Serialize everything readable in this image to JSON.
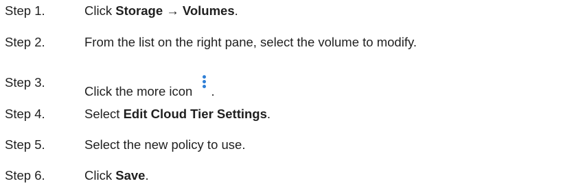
{
  "steps": [
    {
      "label": "Step 1.",
      "parts": [
        {
          "text": "Click "
        },
        {
          "text": "Storage → Volumes",
          "bold": true
        },
        {
          "text": "."
        }
      ]
    },
    {
      "label": "Step 2.",
      "parts": [
        {
          "text": "From the list on the right pane, select the volume to modify."
        }
      ]
    },
    {
      "label": "Step 3.",
      "parts": [
        {
          "text": "Click the more icon "
        },
        {
          "icon": "more-vertical-icon"
        },
        {
          "text": "."
        }
      ]
    },
    {
      "label": "Step 4.",
      "parts": [
        {
          "text": "Select "
        },
        {
          "text": "Edit Cloud Tier Settings",
          "bold": true
        },
        {
          "text": "."
        }
      ]
    },
    {
      "label": "Step 5.",
      "parts": [
        {
          "text": "Select the new policy to use."
        }
      ]
    },
    {
      "label": "Step 6.",
      "parts": [
        {
          "text": "Click "
        },
        {
          "text": "Save",
          "bold": true
        },
        {
          "text": "."
        }
      ]
    }
  ],
  "colors": {
    "text": "#1f1f1f",
    "icon_accent": "#2f7fd6"
  }
}
